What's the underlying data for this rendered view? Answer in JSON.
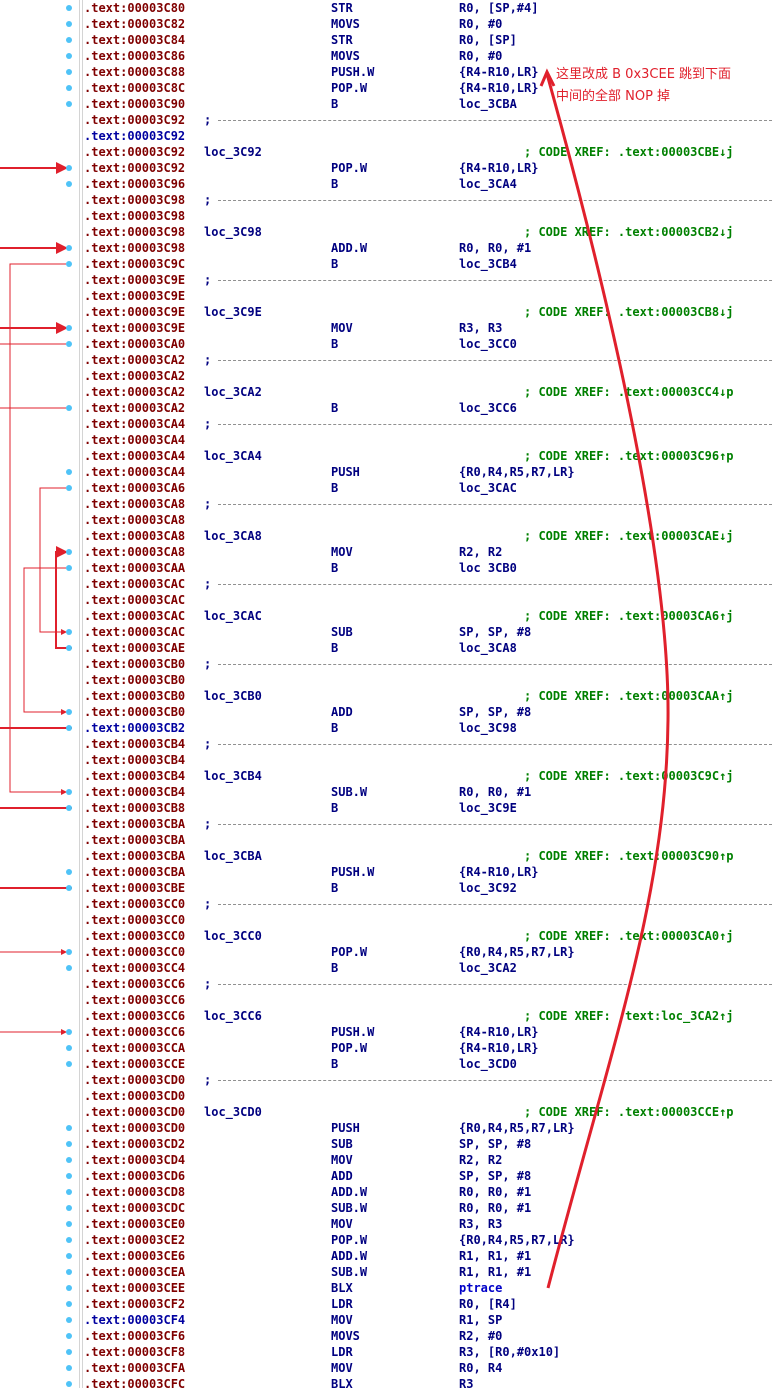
{
  "annotation": {
    "line1": "这里改成 B 0x3CEE 跳到下面",
    "line2": "中间的全部 NOP 掉",
    "color": "#e0202c"
  },
  "colors": {
    "address": "#800000",
    "address_current": "#0000a0",
    "code": "#000080",
    "comment": "#008000",
    "dot": "#4fc3f7",
    "flow_arrow": "#e0202c"
  },
  "listing": [
    {
      "type": "ins",
      "dot": true,
      "addr": ".text:00003C80",
      "mn": "STR",
      "op": "R0, [SP,#4]"
    },
    {
      "type": "ins",
      "dot": true,
      "addr": ".text:00003C82",
      "mn": "MOVS",
      "op": "R0, #0"
    },
    {
      "type": "ins",
      "dot": true,
      "addr": ".text:00003C84",
      "mn": "STR",
      "op": "R0, [SP]"
    },
    {
      "type": "ins",
      "dot": true,
      "addr": ".text:00003C86",
      "mn": "MOVS",
      "op": "R0, #0"
    },
    {
      "type": "ins",
      "dot": true,
      "addr": ".text:00003C88",
      "mn": "PUSH.W",
      "op": "{R4-R10,LR}"
    },
    {
      "type": "ins",
      "dot": true,
      "addr": ".text:00003C8C",
      "mn": "POP.W",
      "op": "{R4-R10,LR}"
    },
    {
      "type": "ins",
      "dot": true,
      "addr": ".text:00003C90",
      "mn": "B",
      "op": "loc_3CBA"
    },
    {
      "type": "sep",
      "addr": ".text:00003C92",
      "semi": ";"
    },
    {
      "type": "blank",
      "addr": ".text:00003C92",
      "blue": true
    },
    {
      "type": "lbl",
      "addr": ".text:00003C92",
      "label": "loc_3C92",
      "comment": "; CODE XREF: .text:00003CBE↓j"
    },
    {
      "type": "ins",
      "dot": true,
      "addr": ".text:00003C92",
      "mn": "POP.W",
      "op": "{R4-R10,LR}"
    },
    {
      "type": "ins",
      "dot": true,
      "addr": ".text:00003C96",
      "mn": "B",
      "op": "loc_3CA4"
    },
    {
      "type": "sep",
      "addr": ".text:00003C98",
      "semi": ";"
    },
    {
      "type": "blank",
      "addr": ".text:00003C98"
    },
    {
      "type": "lbl",
      "addr": ".text:00003C98",
      "label": "loc_3C98",
      "comment": "; CODE XREF: .text:00003CB2↓j"
    },
    {
      "type": "ins",
      "dot": true,
      "addr": ".text:00003C98",
      "mn": "ADD.W",
      "op": "R0, R0, #1"
    },
    {
      "type": "ins",
      "dot": true,
      "addr": ".text:00003C9C",
      "mn": "B",
      "op": "loc_3CB4"
    },
    {
      "type": "sep",
      "addr": ".text:00003C9E",
      "semi": ";"
    },
    {
      "type": "blank",
      "addr": ".text:00003C9E"
    },
    {
      "type": "lbl",
      "addr": ".text:00003C9E",
      "label": "loc_3C9E",
      "comment": "; CODE XREF: .text:00003CB8↓j"
    },
    {
      "type": "ins",
      "dot": true,
      "addr": ".text:00003C9E",
      "mn": "MOV",
      "op": "R3, R3"
    },
    {
      "type": "ins",
      "dot": true,
      "addr": ".text:00003CA0",
      "mn": "B",
      "op": "loc_3CC0"
    },
    {
      "type": "sep",
      "addr": ".text:00003CA2",
      "semi": ";"
    },
    {
      "type": "blank",
      "addr": ".text:00003CA2"
    },
    {
      "type": "lbl",
      "addr": ".text:00003CA2",
      "label": "loc_3CA2",
      "comment": "; CODE XREF: .text:00003CC4↓p"
    },
    {
      "type": "ins",
      "dot": true,
      "addr": ".text:00003CA2",
      "mn": "B",
      "op": "loc_3CC6"
    },
    {
      "type": "sep",
      "addr": ".text:00003CA4",
      "semi": ";"
    },
    {
      "type": "blank",
      "addr": ".text:00003CA4"
    },
    {
      "type": "lbl",
      "addr": ".text:00003CA4",
      "label": "loc_3CA4",
      "comment": "; CODE XREF: .text:00003C96↑p"
    },
    {
      "type": "ins",
      "dot": true,
      "addr": ".text:00003CA4",
      "mn": "PUSH",
      "op": "{R0,R4,R5,R7,LR}"
    },
    {
      "type": "ins",
      "dot": true,
      "addr": ".text:00003CA6",
      "mn": "B",
      "op": "loc_3CAC"
    },
    {
      "type": "sep",
      "addr": ".text:00003CA8",
      "semi": ";"
    },
    {
      "type": "blank",
      "addr": ".text:00003CA8"
    },
    {
      "type": "lbl",
      "addr": ".text:00003CA8",
      "label": "loc_3CA8",
      "comment": "; CODE XREF: .text:00003CAE↓j"
    },
    {
      "type": "ins",
      "dot": true,
      "addr": ".text:00003CA8",
      "mn": "MOV",
      "op": "R2, R2"
    },
    {
      "type": "ins",
      "dot": true,
      "addr": ".text:00003CAA",
      "mn": "B",
      "op": "loc 3CB0"
    },
    {
      "type": "sep",
      "addr": ".text:00003CAC",
      "semi": ";"
    },
    {
      "type": "blank",
      "addr": ".text:00003CAC"
    },
    {
      "type": "lbl",
      "addr": ".text:00003CAC",
      "label": "loc_3CAC",
      "comment": "; CODE XREF: .text:00003CA6↑j"
    },
    {
      "type": "ins",
      "dot": true,
      "addr": ".text:00003CAC",
      "mn": "SUB",
      "op": "SP, SP, #8"
    },
    {
      "type": "ins",
      "dot": true,
      "addr": ".text:00003CAE",
      "mn": "B",
      "op": "loc_3CA8"
    },
    {
      "type": "sep",
      "addr": ".text:00003CB0",
      "semi": ";"
    },
    {
      "type": "blank",
      "addr": ".text:00003CB0"
    },
    {
      "type": "lbl",
      "addr": ".text:00003CB0",
      "label": "loc_3CB0",
      "comment": "; CODE XREF: .text:00003CAA↑j"
    },
    {
      "type": "ins",
      "dot": true,
      "addr": ".text:00003CB0",
      "mn": "ADD",
      "op": "SP, SP, #8"
    },
    {
      "type": "ins",
      "dot": true,
      "addr": ".text:00003CB2",
      "blue": true,
      "mn": "B",
      "op": "loc_3C98"
    },
    {
      "type": "sep",
      "addr": ".text:00003CB4",
      "semi": ";"
    },
    {
      "type": "blank",
      "addr": ".text:00003CB4"
    },
    {
      "type": "lbl",
      "addr": ".text:00003CB4",
      "label": "loc_3CB4",
      "comment": "; CODE XREF: .text:00003C9C↑j"
    },
    {
      "type": "ins",
      "dot": true,
      "addr": ".text:00003CB4",
      "mn": "SUB.W",
      "op": "R0, R0, #1"
    },
    {
      "type": "ins",
      "dot": true,
      "addr": ".text:00003CB8",
      "mn": "B",
      "op": "loc_3C9E"
    },
    {
      "type": "sep",
      "addr": ".text:00003CBA",
      "semi": ";"
    },
    {
      "type": "blank",
      "addr": ".text:00003CBA"
    },
    {
      "type": "lbl",
      "addr": ".text:00003CBA",
      "label": "loc_3CBA",
      "comment": "; CODE XREF: .text:00003C90↑p"
    },
    {
      "type": "ins",
      "dot": true,
      "addr": ".text:00003CBA",
      "mn": "PUSH.W",
      "op": "{R4-R10,LR}"
    },
    {
      "type": "ins",
      "dot": true,
      "addr": ".text:00003CBE",
      "mn": "B",
      "op": "loc_3C92"
    },
    {
      "type": "sep",
      "addr": ".text:00003CC0",
      "semi": ";"
    },
    {
      "type": "blank",
      "addr": ".text:00003CC0"
    },
    {
      "type": "lbl",
      "addr": ".text:00003CC0",
      "label": "loc_3CC0",
      "comment": "; CODE XREF: .text:00003CA0↑j"
    },
    {
      "type": "ins",
      "dot": true,
      "addr": ".text:00003CC0",
      "mn": "POP.W",
      "op": "{R0,R4,R5,R7,LR}"
    },
    {
      "type": "ins",
      "dot": true,
      "addr": ".text:00003CC4",
      "mn": "B",
      "op": "loc_3CA2"
    },
    {
      "type": "sep",
      "addr": ".text:00003CC6",
      "semi": ";"
    },
    {
      "type": "blank",
      "addr": ".text:00003CC6"
    },
    {
      "type": "lbl",
      "addr": ".text:00003CC6",
      "label": "loc_3CC6",
      "comment": "; CODE XREF: .text:loc_3CA2↑j"
    },
    {
      "type": "ins",
      "dot": true,
      "addr": ".text:00003CC6",
      "mn": "PUSH.W",
      "op": "{R4-R10,LR}"
    },
    {
      "type": "ins",
      "dot": true,
      "addr": ".text:00003CCA",
      "mn": "POP.W",
      "op": "{R4-R10,LR}"
    },
    {
      "type": "ins",
      "dot": true,
      "addr": ".text:00003CCE",
      "mn": "B",
      "op": "loc_3CD0"
    },
    {
      "type": "sep",
      "addr": ".text:00003CD0",
      "semi": ";"
    },
    {
      "type": "blank",
      "addr": ".text:00003CD0"
    },
    {
      "type": "lbl",
      "addr": ".text:00003CD0",
      "label": "loc_3CD0",
      "comment": "; CODE XREF: .text:00003CCE↑p"
    },
    {
      "type": "ins",
      "dot": true,
      "addr": ".text:00003CD0",
      "mn": "PUSH",
      "op": "{R0,R4,R5,R7,LR}"
    },
    {
      "type": "ins",
      "dot": true,
      "addr": ".text:00003CD2",
      "mn": "SUB",
      "op": "SP, SP, #8"
    },
    {
      "type": "ins",
      "dot": true,
      "addr": ".text:00003CD4",
      "mn": "MOV",
      "op": "R2, R2"
    },
    {
      "type": "ins",
      "dot": true,
      "addr": ".text:00003CD6",
      "mn": "ADD",
      "op": "SP, SP, #8"
    },
    {
      "type": "ins",
      "dot": true,
      "addr": ".text:00003CD8",
      "mn": "ADD.W",
      "op": "R0, R0, #1"
    },
    {
      "type": "ins",
      "dot": true,
      "addr": ".text:00003CDC",
      "mn": "SUB.W",
      "op": "R0, R0, #1"
    },
    {
      "type": "ins",
      "dot": true,
      "addr": ".text:00003CE0",
      "mn": "MOV",
      "op": "R3, R3"
    },
    {
      "type": "ins",
      "dot": true,
      "addr": ".text:00003CE2",
      "mn": "POP.W",
      "op": "{R0,R4,R5,R7,LR}"
    },
    {
      "type": "ins",
      "dot": true,
      "addr": ".text:00003CE6",
      "mn": "ADD.W",
      "op": "R1, R1, #1"
    },
    {
      "type": "ins",
      "dot": true,
      "addr": ".text:00003CEA",
      "mn": "SUB.W",
      "op": "R1, R1, #1"
    },
    {
      "type": "ins",
      "dot": true,
      "addr": ".text:00003CEE",
      "mn": "BLX",
      "op": "ptrace",
      "opblue": true
    },
    {
      "type": "ins",
      "dot": true,
      "addr": ".text:00003CF2",
      "mn": "LDR",
      "op": "R0, [R4]"
    },
    {
      "type": "ins",
      "dot": true,
      "addr": ".text:00003CF4",
      "blue": true,
      "mn": "MOV",
      "op": "R1, SP"
    },
    {
      "type": "ins",
      "dot": true,
      "addr": ".text:00003CF6",
      "mn": "MOVS",
      "op": "R2, #0"
    },
    {
      "type": "ins",
      "dot": true,
      "addr": ".text:00003CF8",
      "mn": "LDR",
      "op": "R3, [R0,#0x10]"
    },
    {
      "type": "ins",
      "dot": true,
      "addr": ".text:00003CFA",
      "mn": "MOV",
      "op": "R0, R4"
    },
    {
      "type": "ins",
      "dot": true,
      "addr": ".text:00003CFC",
      "mn": "BLX",
      "op": "R3"
    }
  ]
}
